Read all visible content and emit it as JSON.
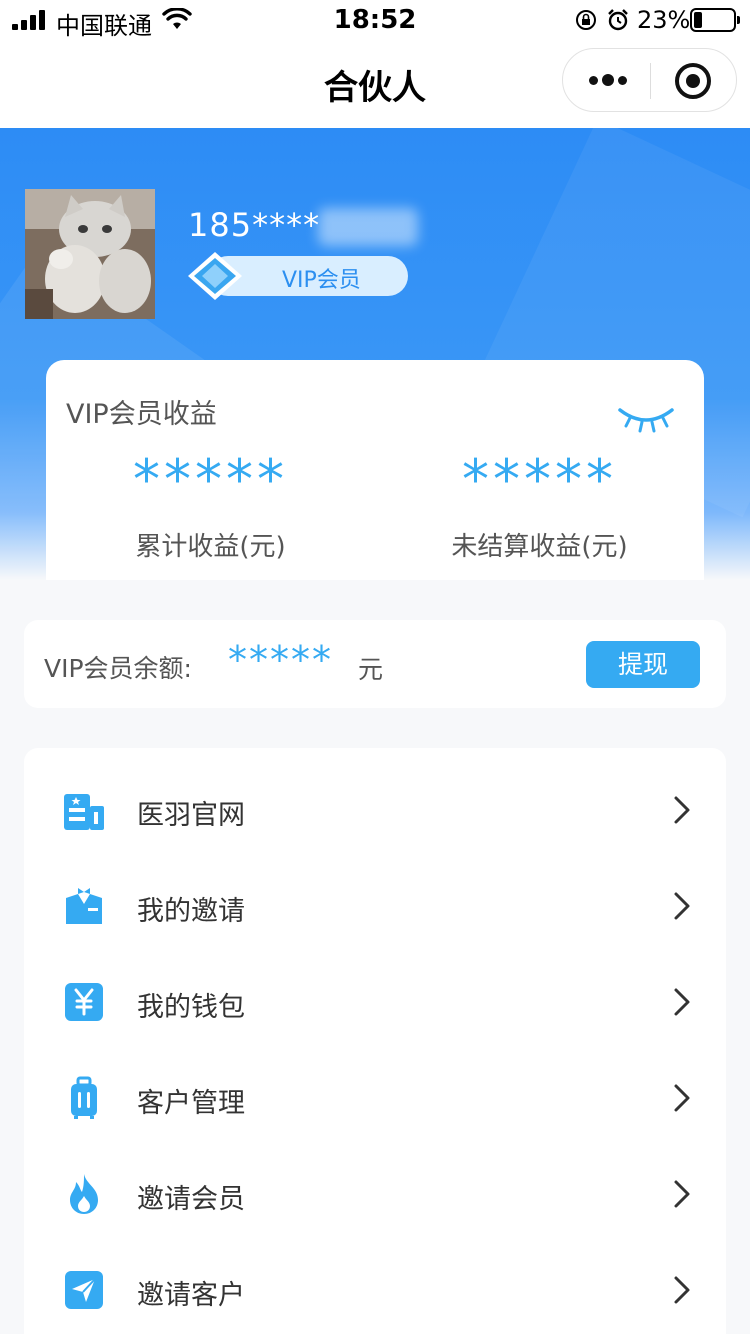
{
  "status_bar": {
    "carrier": "中国联通",
    "time": "18:52",
    "battery": "23%"
  },
  "nav": {
    "title": "合伙人"
  },
  "profile": {
    "username": "185****",
    "vip_badge": "VIP会员"
  },
  "earnings": {
    "title": "VIP会员收益",
    "total_value": "*****",
    "total_label": "累计收益(元)",
    "unsettled_value": "*****",
    "unsettled_label": "未结算收益(元)"
  },
  "balance": {
    "label": "VIP会员余额:",
    "value": "*****",
    "unit": "元",
    "withdraw": "提现"
  },
  "menu": [
    {
      "label": "医羽官网",
      "icon": "building-icon"
    },
    {
      "label": "我的邀请",
      "icon": "suit-icon"
    },
    {
      "label": "我的钱包",
      "icon": "yuan-icon"
    },
    {
      "label": "客户管理",
      "icon": "luggage-icon"
    },
    {
      "label": "邀请会员",
      "icon": "flame-icon"
    },
    {
      "label": "邀请客户",
      "icon": "send-icon"
    }
  ],
  "colors": {
    "accent": "#35aaf2",
    "banner": "#2d8cf5"
  }
}
